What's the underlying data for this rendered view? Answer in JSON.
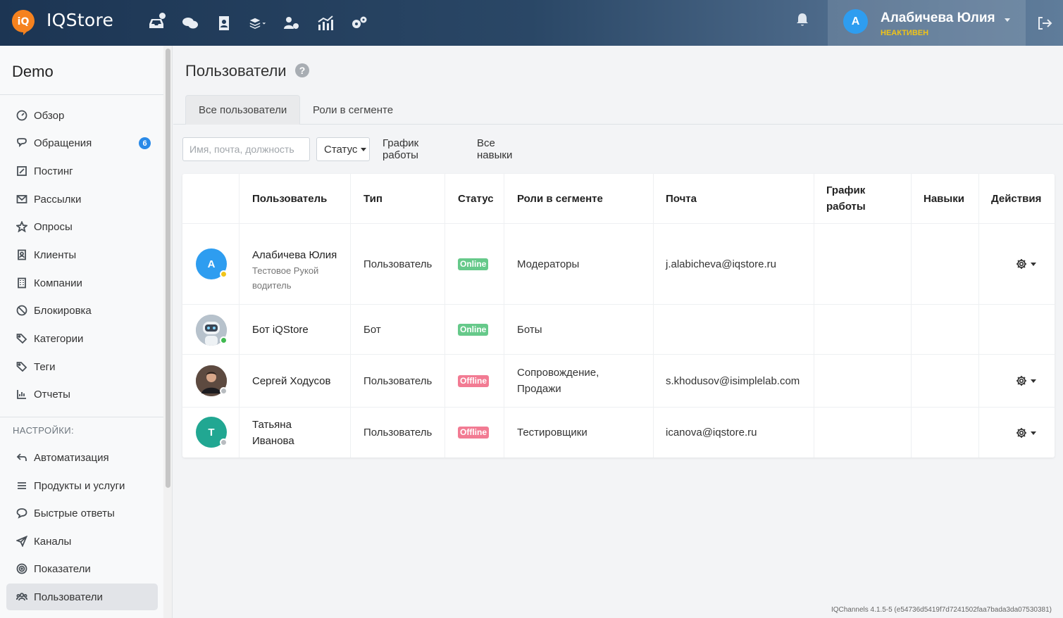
{
  "app": {
    "logo_text": "IQStore",
    "logo_glyph": "iQ"
  },
  "header": {
    "user": {
      "initial": "A",
      "name": "Алабичева Юлия",
      "status": "НЕАКТИВЕН"
    },
    "icons": [
      "inbox-icon",
      "chats-icon",
      "contacts-icon",
      "layers-icon",
      "users-gear-icon",
      "analytics-icon",
      "settings-icon"
    ]
  },
  "sidebar": {
    "segment": "Demo",
    "items": [
      {
        "label": "Обзор",
        "icon": "dashboard-icon"
      },
      {
        "label": "Обращения",
        "icon": "chat-icon",
        "badge": "6"
      },
      {
        "label": "Постинг",
        "icon": "edit-icon"
      },
      {
        "label": "Рассылки",
        "icon": "mail-icon"
      },
      {
        "label": "Опросы",
        "icon": "star-icon"
      },
      {
        "label": "Клиенты",
        "icon": "contact-book-icon"
      },
      {
        "label": "Компании",
        "icon": "building-icon"
      },
      {
        "label": "Блокировка",
        "icon": "ban-icon"
      },
      {
        "label": "Категории",
        "icon": "tags-icon"
      },
      {
        "label": "Теги",
        "icon": "tag-icon"
      },
      {
        "label": "Отчеты",
        "icon": "bar-chart-icon"
      }
    ],
    "settings_title": "НАСТРОЙКИ:",
    "settings_items": [
      {
        "label": "Автоматизация",
        "icon": "automation-icon"
      },
      {
        "label": "Продукты и услуги",
        "icon": "list-icon"
      },
      {
        "label": "Быстрые ответы",
        "icon": "quick-reply-icon"
      },
      {
        "label": "Каналы",
        "icon": "send-icon"
      },
      {
        "label": "Показатели",
        "icon": "target-icon"
      },
      {
        "label": "Пользователи",
        "icon": "users-icon",
        "active": true
      }
    ]
  },
  "main": {
    "title": "Пользователи",
    "help": "?",
    "tabs": [
      {
        "label": "Все пользователи",
        "active": true
      },
      {
        "label": "Роли в сегменте"
      }
    ],
    "filters": {
      "search_placeholder": "Имя, почта, должность",
      "search_value": "",
      "status_label": "Статус",
      "schedule_label": "График работы",
      "skills_label": "Все навыки"
    },
    "table": {
      "headers": {
        "user": "Пользователь",
        "type": "Тип",
        "status": "Статус",
        "roles": "Роли в сегменте",
        "email": "Почта",
        "schedule": "График работы",
        "skills": "Навыки",
        "actions": "Действия"
      },
      "rows": [
        {
          "initial": "A",
          "avatar_color": "#2e9df0",
          "presence": "#f0c419",
          "name": "Алабичева Юлия",
          "sub": "Тестовое Рукой водитель",
          "type": "Пользователь",
          "status": "Online",
          "roles": "Модераторы",
          "email": "j.alabicheva@iqstore.ru",
          "has_actions": true
        },
        {
          "initial": "",
          "avatar_color": "#9aa3ad",
          "presence": "#3fb950",
          "name": "Бот iQStore",
          "sub": "",
          "type": "Бот",
          "status": "Online",
          "roles": "Боты",
          "email": "",
          "has_actions": false
        },
        {
          "initial": "",
          "avatar_color": "#4a3b34",
          "presence": "#b8bcc0",
          "name": "Сергей Ходусов",
          "sub": "",
          "type": "Пользователь",
          "status": "Offline",
          "roles": "Сопровождение, Продажи",
          "email": "s.khodusov@isimplelab.com",
          "has_actions": true
        },
        {
          "initial": "T",
          "avatar_color": "#21a792",
          "presence": "#b8bcc0",
          "name": "Татьяна Иванова",
          "sub": "",
          "type": "Пользователь",
          "status": "Offline",
          "roles": "Тестировщики",
          "email": "icanova@iqstore.ru",
          "has_actions": true
        }
      ]
    },
    "version": "IQChannels 4.1.5-5 (e54736d5419f7d7241502faa7bada3da07530381)"
  },
  "colors": {
    "accent": "#2a8ae8",
    "online": "#66c98a",
    "offline": "#f27b93",
    "logo": "#f5821f"
  }
}
